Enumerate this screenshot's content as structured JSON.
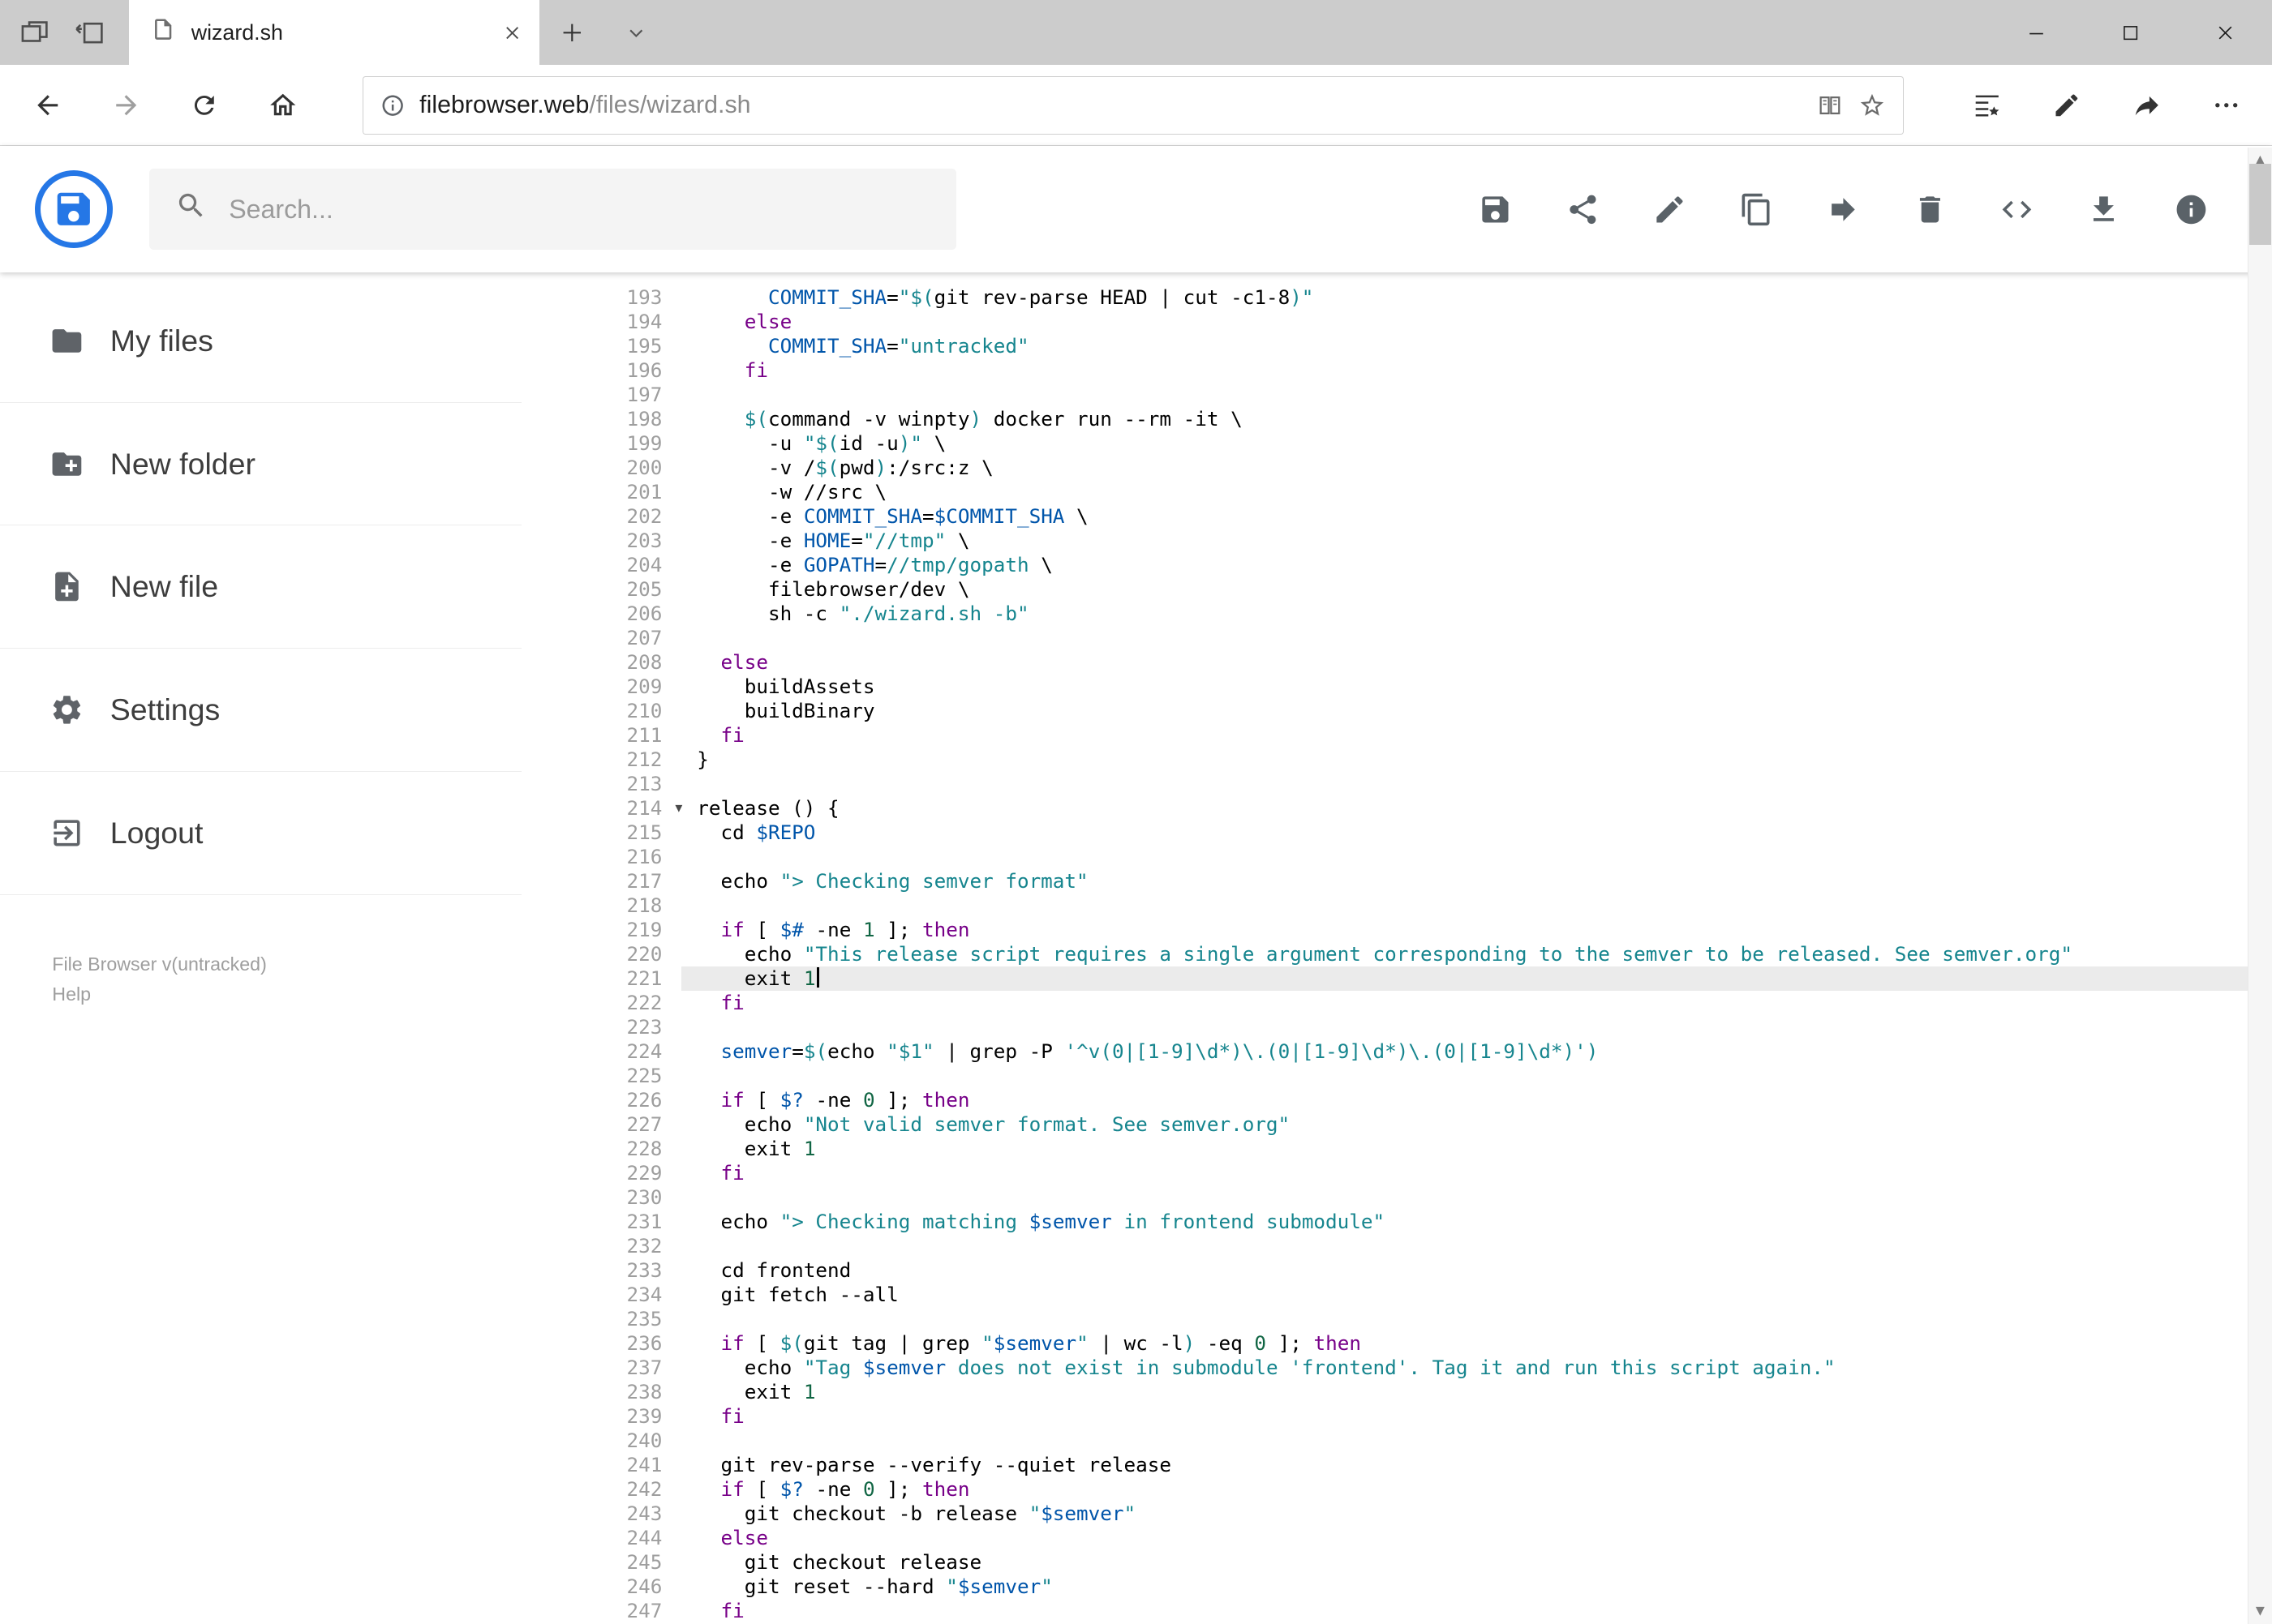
{
  "browser": {
    "tab": {
      "title": "wizard.sh"
    },
    "address": {
      "host": "filebrowser.web",
      "path": "/files/wizard.sh"
    }
  },
  "app": {
    "search": {
      "placeholder": "Search..."
    },
    "toolbar": [
      "save",
      "share",
      "edit",
      "copy",
      "move",
      "delete",
      "code",
      "download",
      "info"
    ],
    "sidebar": {
      "items": [
        {
          "icon": "folder",
          "label": "My files"
        },
        {
          "icon": "new-folder",
          "label": "New folder"
        },
        {
          "icon": "new-file",
          "label": "New file"
        },
        {
          "icon": "settings",
          "label": "Settings"
        },
        {
          "icon": "logout",
          "label": "Logout"
        }
      ],
      "version": "File Browser v(untracked)",
      "help": "Help"
    },
    "editor": {
      "first_line": 193,
      "active_line": 221,
      "fold_line": 214,
      "fold_marker": "▾",
      "lines": [
        [
          [
            "t",
            "      "
          ],
          [
            "v",
            "COMMIT_SHA"
          ],
          [
            "t",
            "="
          ],
          [
            "s",
            "\"$("
          ],
          [
            "t",
            "git rev-parse HEAD | cut -c1-8"
          ],
          [
            "s",
            ")\""
          ]
        ],
        [
          [
            "t",
            "    "
          ],
          [
            "k",
            "else"
          ]
        ],
        [
          [
            "t",
            "      "
          ],
          [
            "v",
            "COMMIT_SHA"
          ],
          [
            "t",
            "="
          ],
          [
            "s",
            "\"untracked\""
          ]
        ],
        [
          [
            "t",
            "    "
          ],
          [
            "k",
            "fi"
          ]
        ],
        [],
        [
          [
            "t",
            "    "
          ],
          [
            "s",
            "$("
          ],
          [
            "t",
            "command -v winpty"
          ],
          [
            "s",
            ")"
          ],
          [
            "t",
            " docker run --rm -it \\"
          ]
        ],
        [
          [
            "t",
            "      -u "
          ],
          [
            "s",
            "\"$("
          ],
          [
            "t",
            "id -u"
          ],
          [
            "s",
            ")\""
          ],
          [
            "t",
            " \\"
          ]
        ],
        [
          [
            "t",
            "      -v /"
          ],
          [
            "s",
            "$("
          ],
          [
            "t",
            "pwd"
          ],
          [
            "s",
            ")"
          ],
          [
            "t",
            ":/src:z \\"
          ]
        ],
        [
          [
            "t",
            "      -w //src \\"
          ]
        ],
        [
          [
            "t",
            "      -e "
          ],
          [
            "v",
            "COMMIT_SHA"
          ],
          [
            "t",
            "="
          ],
          [
            "v",
            "$COMMIT_SHA"
          ],
          [
            "t",
            " \\"
          ]
        ],
        [
          [
            "t",
            "      -e "
          ],
          [
            "v",
            "HOME"
          ],
          [
            "t",
            "="
          ],
          [
            "s",
            "\"//tmp\""
          ],
          [
            "t",
            " \\"
          ]
        ],
        [
          [
            "t",
            "      -e "
          ],
          [
            "v",
            "GOPATH"
          ],
          [
            "t",
            "="
          ],
          [
            "s",
            "//tmp/gopath"
          ],
          [
            "t",
            " \\"
          ]
        ],
        [
          [
            "t",
            "      filebrowser/dev \\"
          ]
        ],
        [
          [
            "t",
            "      sh -c "
          ],
          [
            "s",
            "\"./wizard.sh -b\""
          ]
        ],
        [],
        [
          [
            "t",
            "  "
          ],
          [
            "k",
            "else"
          ]
        ],
        [
          [
            "t",
            "    buildAssets"
          ]
        ],
        [
          [
            "t",
            "    buildBinary"
          ]
        ],
        [
          [
            "t",
            "  "
          ],
          [
            "k",
            "fi"
          ]
        ],
        [
          [
            "t",
            "}"
          ]
        ],
        [],
        [
          [
            "t",
            "release () {"
          ]
        ],
        [
          [
            "t",
            "  cd "
          ],
          [
            "v",
            "$REPO"
          ]
        ],
        [],
        [
          [
            "t",
            "  echo "
          ],
          [
            "s",
            "\"> Checking semver format\""
          ]
        ],
        [],
        [
          [
            "t",
            "  "
          ],
          [
            "k",
            "if"
          ],
          [
            "t",
            " [ "
          ],
          [
            "v",
            "$#"
          ],
          [
            "t",
            " -ne "
          ],
          [
            "n",
            "1"
          ],
          [
            "t",
            " ]; "
          ],
          [
            "k",
            "then"
          ]
        ],
        [
          [
            "t",
            "    echo "
          ],
          [
            "s",
            "\"This release script requires a single argument corresponding to the semver to be released. See semver.org\""
          ]
        ],
        [
          [
            "t",
            "    exit "
          ],
          [
            "n",
            "1"
          ]
        ],
        [
          [
            "t",
            "  "
          ],
          [
            "k",
            "fi"
          ]
        ],
        [],
        [
          [
            "t",
            "  "
          ],
          [
            "v",
            "semver"
          ],
          [
            "t",
            "="
          ],
          [
            "s",
            "$("
          ],
          [
            "t",
            "echo "
          ],
          [
            "s",
            "\"$1\""
          ],
          [
            "t",
            " | grep -P "
          ],
          [
            "s",
            "'^v(0|[1-9]\\d*)\\.(0|[1-9]\\d*)\\.(0|[1-9]\\d*)'"
          ],
          [
            "s",
            ")"
          ]
        ],
        [],
        [
          [
            "t",
            "  "
          ],
          [
            "k",
            "if"
          ],
          [
            "t",
            " [ "
          ],
          [
            "v",
            "$?"
          ],
          [
            "t",
            " -ne "
          ],
          [
            "n",
            "0"
          ],
          [
            "t",
            " ]; "
          ],
          [
            "k",
            "then"
          ]
        ],
        [
          [
            "t",
            "    echo "
          ],
          [
            "s",
            "\"Not valid semver format. See semver.org\""
          ]
        ],
        [
          [
            "t",
            "    exit "
          ],
          [
            "n",
            "1"
          ]
        ],
        [
          [
            "t",
            "  "
          ],
          [
            "k",
            "fi"
          ]
        ],
        [],
        [
          [
            "t",
            "  echo "
          ],
          [
            "s",
            "\"> Checking matching "
          ],
          [
            "v",
            "$semver"
          ],
          [
            "s",
            " in frontend submodule\""
          ]
        ],
        [],
        [
          [
            "t",
            "  cd frontend"
          ]
        ],
        [
          [
            "t",
            "  git fetch --all"
          ]
        ],
        [],
        [
          [
            "t",
            "  "
          ],
          [
            "k",
            "if"
          ],
          [
            "t",
            " [ "
          ],
          [
            "s",
            "$("
          ],
          [
            "t",
            "git tag | grep "
          ],
          [
            "s",
            "\""
          ],
          [
            "v",
            "$semver"
          ],
          [
            "s",
            "\""
          ],
          [
            "t",
            " | wc -l"
          ],
          [
            "s",
            ")"
          ],
          [
            "t",
            " -eq "
          ],
          [
            "n",
            "0"
          ],
          [
            "t",
            " ]; "
          ],
          [
            "k",
            "then"
          ]
        ],
        [
          [
            "t",
            "    echo "
          ],
          [
            "s",
            "\"Tag "
          ],
          [
            "v",
            "$semver"
          ],
          [
            "s",
            " does not exist in submodule 'frontend'. Tag it and run this script again.\""
          ]
        ],
        [
          [
            "t",
            "    exit "
          ],
          [
            "n",
            "1"
          ]
        ],
        [
          [
            "t",
            "  "
          ],
          [
            "k",
            "fi"
          ]
        ],
        [],
        [
          [
            "t",
            "  git rev-parse --verify --quiet release"
          ]
        ],
        [
          [
            "t",
            "  "
          ],
          [
            "k",
            "if"
          ],
          [
            "t",
            " [ "
          ],
          [
            "v",
            "$?"
          ],
          [
            "t",
            " -ne "
          ],
          [
            "n",
            "0"
          ],
          [
            "t",
            " ]; "
          ],
          [
            "k",
            "then"
          ]
        ],
        [
          [
            "t",
            "    git checkout -b release "
          ],
          [
            "s",
            "\""
          ],
          [
            "v",
            "$semver"
          ],
          [
            "s",
            "\""
          ]
        ],
        [
          [
            "t",
            "  "
          ],
          [
            "k",
            "else"
          ]
        ],
        [
          [
            "t",
            "    git checkout release"
          ]
        ],
        [
          [
            "t",
            "    git reset --hard "
          ],
          [
            "s",
            "\""
          ],
          [
            "v",
            "$semver"
          ],
          [
            "s",
            "\""
          ]
        ],
        [
          [
            "t",
            "  "
          ],
          [
            "k",
            "fi"
          ]
        ]
      ]
    }
  }
}
